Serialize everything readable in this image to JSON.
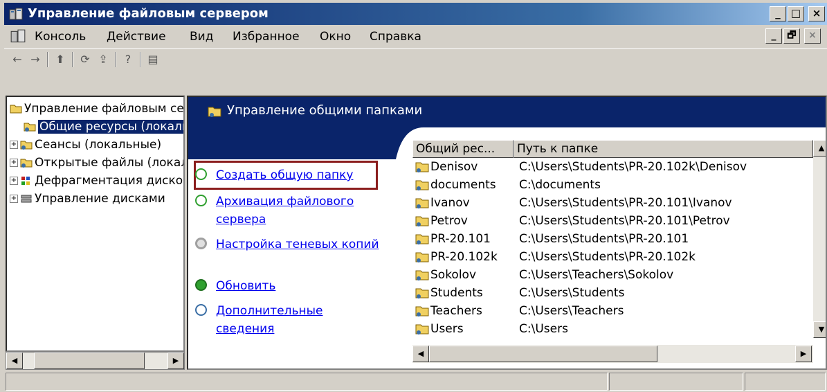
{
  "window": {
    "title": "Управление файловым сервером",
    "caption_buttons": {
      "minimize": "_",
      "maximize": "□",
      "close": "×"
    }
  },
  "menu": {
    "items": [
      {
        "label": "Консоль"
      },
      {
        "label": "Действие"
      },
      {
        "label": "Вид"
      },
      {
        "label": "Избранное"
      },
      {
        "label": "Окно"
      },
      {
        "label": "Справка"
      }
    ],
    "mdi_buttons": {
      "minimize": "_",
      "restore": "🗗",
      "close": "×"
    }
  },
  "toolbar": {
    "back": "←",
    "forward": "→",
    "up": "⬆",
    "refresh": "⟳",
    "export": "⇪",
    "help": "?",
    "action": "▤"
  },
  "tree": {
    "items": [
      {
        "label": "Управление файловым сервером",
        "icon": "folder-icon"
      },
      {
        "label": "Общие ресурсы (локальные)",
        "icon": "shared-folder-icon",
        "selected": true
      },
      {
        "label": "Сеансы (локальные)",
        "icon": "sessions-icon",
        "expander": "+"
      },
      {
        "label": "Открытые файлы (локальные)",
        "icon": "open-files-icon",
        "expander": "+"
      },
      {
        "label": "Дефрагментация дисков",
        "icon": "defrag-icon",
        "expander": "+"
      },
      {
        "label": "Управление дисками",
        "icon": "disk-management-icon",
        "expander": "+"
      }
    ]
  },
  "panel": {
    "title": "Управление общими папками"
  },
  "tasks": [
    {
      "label": "Создать общую папку",
      "icon": "green-arrow-icon"
    },
    {
      "label": "Архивация файлового сервера",
      "icon": "green-arrow-icon"
    },
    {
      "label": "Настройка теневых копий",
      "icon": "gray-circle-icon"
    },
    {
      "label": "Обновить",
      "icon": "refresh-icon"
    },
    {
      "label": "Дополнительные сведения",
      "icon": "help-icon"
    }
  ],
  "shares": {
    "columns": [
      "Общий рес...",
      "Путь к папке"
    ],
    "rows": [
      {
        "name": "Denisov",
        "path": "C:\\Users\\Students\\PR-20.102k\\Denisov"
      },
      {
        "name": "documents",
        "path": "C:\\documents"
      },
      {
        "name": "Ivanov",
        "path": "C:\\Users\\Students\\PR-20.101\\Ivanov"
      },
      {
        "name": "Petrov",
        "path": "C:\\Users\\Students\\PR-20.101\\Petrov"
      },
      {
        "name": "PR-20.101",
        "path": "C:\\Users\\Students\\PR-20.101"
      },
      {
        "name": "PR-20.102k",
        "path": "C:\\Users\\Students\\PR-20.102k"
      },
      {
        "name": "Sokolov",
        "path": "C:\\Users\\Teachers\\Sokolov"
      },
      {
        "name": "Students",
        "path": "C:\\Users\\Students"
      },
      {
        "name": "Teachers",
        "path": "C:\\Users\\Teachers"
      },
      {
        "name": "Users",
        "path": "C:\\Users"
      }
    ]
  },
  "colors": {
    "titlebar": "#0a246a",
    "highlight_box": "#8b1e1e",
    "link": "#0000ee"
  }
}
